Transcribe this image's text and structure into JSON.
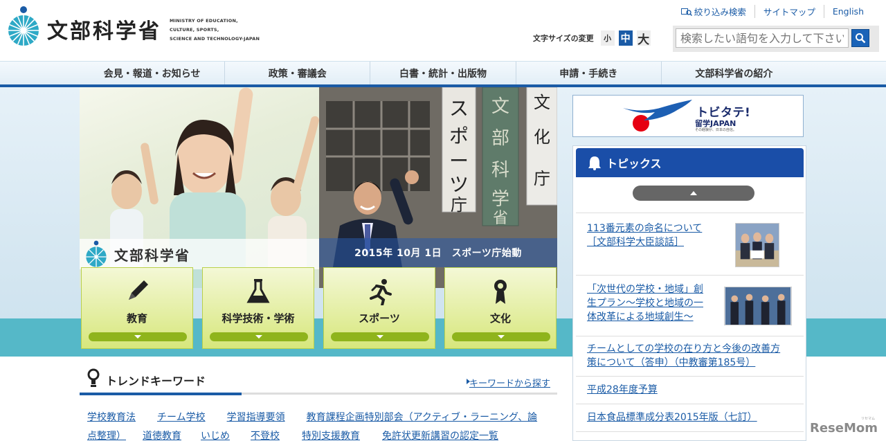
{
  "header": {
    "logo_name": "文部科学省",
    "logo_en_lines": [
      "MINISTRY OF EDUCATION,",
      "CULTURE, SPORTS,",
      "SCIENCE AND TECHNOLOGY-JAPAN"
    ],
    "util_links": [
      "絞り込み検索",
      "サイトマップ",
      "English"
    ],
    "fontsize_label": "文字サイズの変更",
    "fontsize_options": [
      "小",
      "中",
      "大"
    ],
    "search_placeholder": "検索したい語句を入力して下さい。"
  },
  "nav": {
    "items": [
      "会見・報道・お知らせ",
      "政策・審議会",
      "白書・統計・出版物",
      "申請・手続き",
      "文部科学省の紹介"
    ]
  },
  "hero": {
    "left_logo": "文部科学省",
    "right_caption": "2015年 10月 1日　スポーツ庁始動",
    "signs": [
      "スポーツ庁",
      "文部科学省",
      "文化庁"
    ]
  },
  "tiles": [
    {
      "label": "教育",
      "icon": "pencil-icon"
    },
    {
      "label": "科学技術・学術",
      "icon": "flask-icon"
    },
    {
      "label": "スポーツ",
      "icon": "runner-icon"
    },
    {
      "label": "文化",
      "icon": "ribbon-icon"
    }
  ],
  "trend": {
    "title": "トレンドキーワード",
    "search_link": "キーワードから探す",
    "row1": [
      "学校教育法",
      "チーム学校",
      "学習指導要領",
      "教育課程企画特別部会（アクティブ・ラーニング、論"
    ],
    "row2": [
      "点整理）",
      "道徳教育",
      "いじめ",
      "不登校",
      "特別支援教育",
      "免許状更新講習の認定一覧"
    ]
  },
  "banner": {
    "title": "トビタテ!",
    "sub": "留学JAPAN",
    "tiny": "その経験が、日本の自信。"
  },
  "topics": {
    "title": "トピックス",
    "items": [
      {
        "lines": [
          "113番元素の命名について",
          "［文部科学大臣談話］"
        ]
      },
      {
        "lines": [
          "「次世代の学校・地域」創",
          "生プラン～学校と地域の一",
          "体改革による地域創生～"
        ]
      },
      {
        "lines": [
          "チームとしての学校の在り方と今後の改善方",
          "策について（答申）（中教審第185号）"
        ]
      },
      {
        "lines": [
          "平成28年度予算"
        ]
      },
      {
        "lines": [
          "日本食品標準成分表2015年版（七訂）"
        ]
      }
    ]
  },
  "watermark": {
    "name": "ReseMom",
    "sub": "リセマム"
  },
  "colors": {
    "brand_blue": "#1a5ba6",
    "tile_green": "#d7e77c",
    "teal": "#55b8c8",
    "topics_head": "#1a4ea8"
  }
}
